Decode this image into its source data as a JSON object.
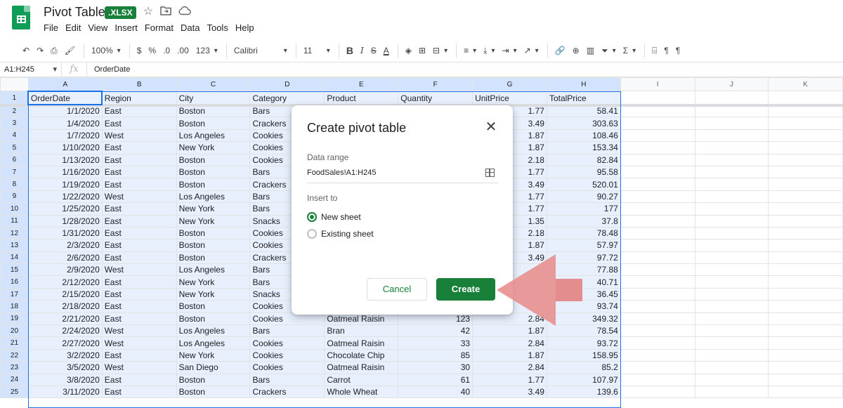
{
  "header": {
    "title": "Pivot Table",
    "badge": ".XLSX",
    "menu": [
      "File",
      "Edit",
      "View",
      "Insert",
      "Format",
      "Data",
      "Tools",
      "Help"
    ]
  },
  "toolbar": {
    "zoom": "100%",
    "currency": "$",
    "percent": "%",
    "dec_decrease": ".0",
    "dec_increase": ".00",
    "more_formats": "123",
    "font": "Calibri",
    "font_size": "11",
    "bold": "B",
    "italic": "I",
    "strike": "S",
    "text_color": "A",
    "sum": "Σ"
  },
  "formula_bar": {
    "cell_ref": "A1:H245",
    "fx": "fx",
    "value": "OrderDate"
  },
  "columns": [
    "A",
    "B",
    "C",
    "D",
    "E",
    "F",
    "G",
    "H",
    "I",
    "J",
    "K"
  ],
  "rows": [
    [
      "OrderDate",
      "Region",
      "City",
      "Category",
      "Product",
      "Quantity",
      "UnitPrice",
      "TotalPrice"
    ],
    [
      "1/1/2020",
      "East",
      "Boston",
      "Bars",
      "",
      "",
      "1.77",
      "58.41"
    ],
    [
      "1/4/2020",
      "East",
      "Boston",
      "Crackers",
      "",
      "",
      "3.49",
      "303.63"
    ],
    [
      "1/7/2020",
      "West",
      "Los Angeles",
      "Cookies",
      "",
      "",
      "1.87",
      "108.46"
    ],
    [
      "1/10/2020",
      "East",
      "New York",
      "Cookies",
      "",
      "",
      "1.87",
      "153.34"
    ],
    [
      "1/13/2020",
      "East",
      "Boston",
      "Cookies",
      "",
      "",
      "2.18",
      "82.84"
    ],
    [
      "1/16/2020",
      "East",
      "Boston",
      "Bars",
      "",
      "",
      "1.77",
      "95.58"
    ],
    [
      "1/19/2020",
      "East",
      "Boston",
      "Crackers",
      "",
      "",
      "3.49",
      "520.01"
    ],
    [
      "1/22/2020",
      "West",
      "Los Angeles",
      "Bars",
      "",
      "",
      "1.77",
      "90.27"
    ],
    [
      "1/25/2020",
      "East",
      "New York",
      "Bars",
      "",
      "",
      "1.77",
      "177"
    ],
    [
      "1/28/2020",
      "East",
      "New York",
      "Snacks",
      "",
      "",
      "1.35",
      "37.8"
    ],
    [
      "1/31/2020",
      "East",
      "Boston",
      "Cookies",
      "",
      "",
      "2.18",
      "78.48"
    ],
    [
      "2/3/2020",
      "East",
      "Boston",
      "Cookies",
      "",
      "",
      "1.87",
      "57.97"
    ],
    [
      "2/6/2020",
      "East",
      "Boston",
      "Crackers",
      "",
      "",
      "3.49",
      "97.72"
    ],
    [
      "2/9/2020",
      "West",
      "Los Angeles",
      "Bars",
      "",
      "",
      "",
      "77.88"
    ],
    [
      "2/12/2020",
      "East",
      "New York",
      "Bars",
      "",
      "",
      "",
      "40.71"
    ],
    [
      "2/15/2020",
      "East",
      "New York",
      "Snacks",
      "",
      "",
      "",
      "36.45"
    ],
    [
      "2/18/2020",
      "East",
      "Boston",
      "Cookies",
      "",
      "",
      "",
      "93.74"
    ],
    [
      "2/21/2020",
      "East",
      "Boston",
      "Cookies",
      "Oatmeal Raisin",
      "123",
      "2.84",
      "349.32"
    ],
    [
      "2/24/2020",
      "West",
      "Los Angeles",
      "Bars",
      "Bran",
      "42",
      "1.87",
      "78.54"
    ],
    [
      "2/27/2020",
      "West",
      "Los Angeles",
      "Cookies",
      "Oatmeal Raisin",
      "33",
      "2.84",
      "93.72"
    ],
    [
      "3/2/2020",
      "East",
      "New York",
      "Cookies",
      "Chocolate Chip",
      "85",
      "1.87",
      "158.95"
    ],
    [
      "3/5/2020",
      "West",
      "San Diego",
      "Cookies",
      "Oatmeal Raisin",
      "30",
      "2.84",
      "85.2"
    ],
    [
      "3/8/2020",
      "East",
      "Boston",
      "Bars",
      "Carrot",
      "61",
      "1.77",
      "107.97"
    ],
    [
      "3/11/2020",
      "East",
      "Boston",
      "Crackers",
      "Whole Wheat",
      "40",
      "3.49",
      "139.6"
    ]
  ],
  "dialog": {
    "title": "Create pivot table",
    "data_range_label": "Data range",
    "data_range_value": "FoodSales!A1:H245",
    "insert_to_label": "Insert to",
    "option_new": "New sheet",
    "option_existing": "Existing sheet",
    "cancel": "Cancel",
    "create": "Create"
  },
  "colors": {
    "accent_green": "#188038",
    "selection_blue": "#1a73e8",
    "arrow": "#e88f8f"
  }
}
